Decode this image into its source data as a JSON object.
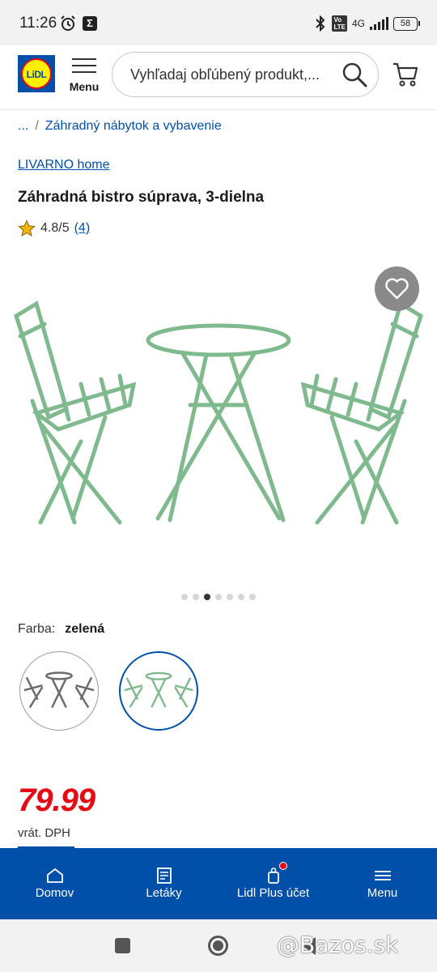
{
  "status_bar": {
    "time": "11:26",
    "network": "4G",
    "battery": "58"
  },
  "header": {
    "logo_text": "LiDL",
    "menu_label": "Menu",
    "search_placeholder": "Vyhľadaj obľúbený produkt,..."
  },
  "breadcrumb": {
    "ellipsis": "...",
    "separator": "/",
    "category": "Záhradný nábytok a vybavenie"
  },
  "product": {
    "brand": "LIVARNO home",
    "title": "Záhradná bistro súprava, 3-dielna",
    "rating": "4.8/5",
    "review_count": "(4)",
    "gallery": {
      "image_count": 7,
      "active_index": 2
    },
    "color_label": "Farba:",
    "color_value": "zelená",
    "variants": [
      {
        "name": "grey-variant",
        "color": "#6b6b6b",
        "selected": false
      },
      {
        "name": "green-variant",
        "color": "#7fba8e",
        "selected": true
      }
    ],
    "price": "79.99",
    "price_note": "vrát. DPH"
  },
  "bottom_nav": [
    {
      "label": "Domov",
      "icon": "home-icon"
    },
    {
      "label": "Letáky",
      "icon": "leaflet-icon"
    },
    {
      "label": "Lidl Plus účet",
      "icon": "lidl-plus-icon",
      "badge": true
    },
    {
      "label": "Menu",
      "icon": "menu-icon"
    }
  ],
  "watermark": "@Bazos.sk",
  "colors": {
    "brand_blue": "#0050aa",
    "price_red": "#e60a14",
    "furniture_green": "#7fba8e",
    "logo_yellow": "#fff000"
  }
}
